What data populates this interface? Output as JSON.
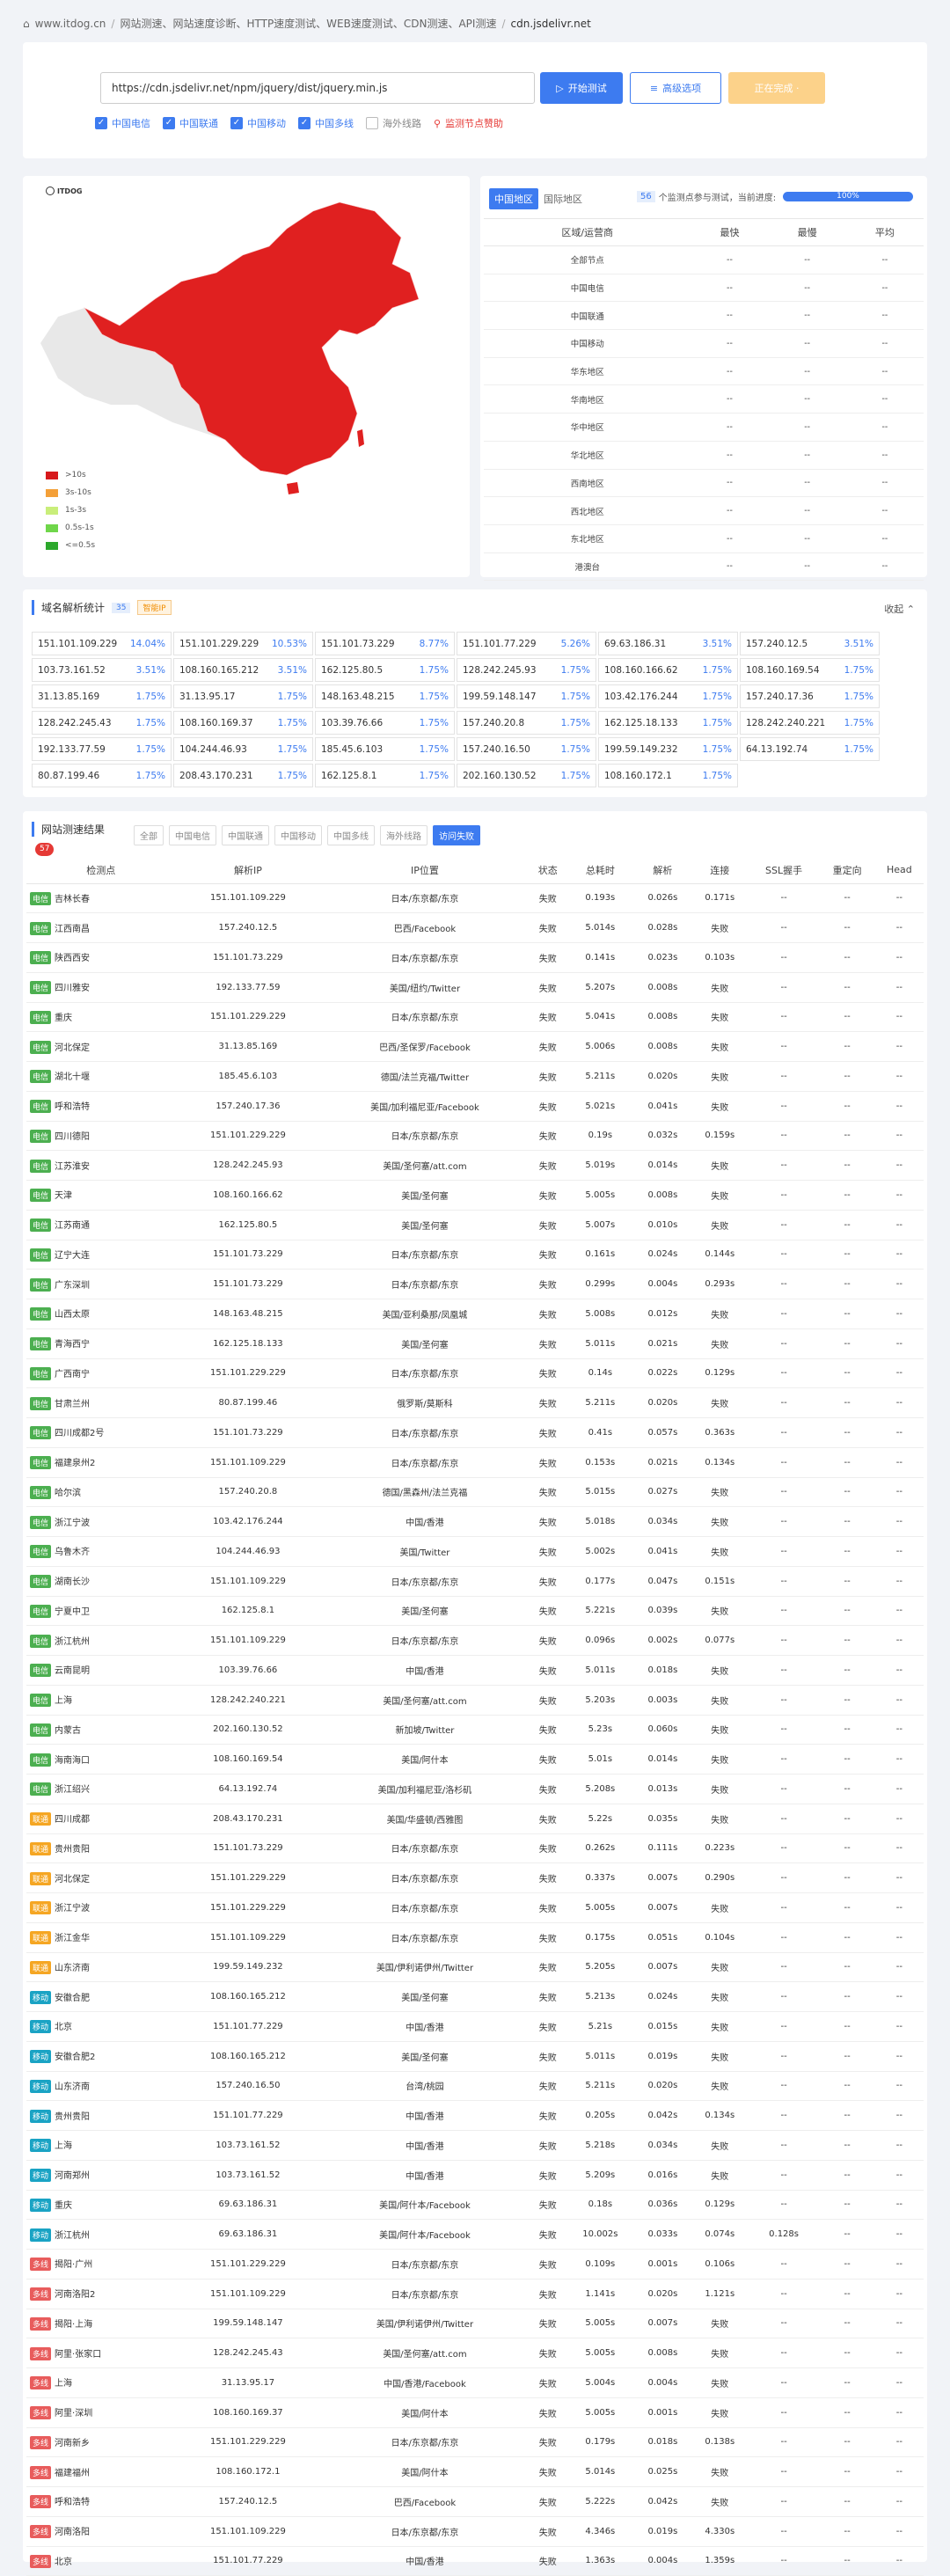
{
  "breadcrumb": [
    "www.itdog.cn",
    "网站测速、网站速度诊断、HTTP速度测试、WEB速度测试、CDN测速、API测速",
    "cdn.jsdelivr.net"
  ],
  "test": {
    "url": "https://cdn.jsdelivr.net/npm/jquery/dist/jquery.min.js",
    "start_label": "开始测试",
    "advanced_label": "高级选项",
    "running_label": "正在完成 ·"
  },
  "lines": [
    {
      "label": "中国电信",
      "checked": true
    },
    {
      "label": "中国联通",
      "checked": true
    },
    {
      "label": "中国移动",
      "checked": true
    },
    {
      "label": "中国多线",
      "checked": true
    },
    {
      "label": "海外线路",
      "checked": false
    }
  ],
  "monitor_label": "监测节点赞助",
  "map": {
    "logo": "ITDOG",
    "legend": [
      {
        "label": ">10s",
        "color": "#d7191c"
      },
      {
        "label": "3s-10s",
        "color": "#f4a038"
      },
      {
        "label": "1s-3s",
        "color": "#c9ee7a"
      },
      {
        "label": "0.5s-1s",
        "color": "#6fd64a"
      },
      {
        "label": "<=0.5s",
        "color": "#2ca82c"
      }
    ]
  },
  "region": {
    "tabs": [
      "中国地区",
      "国际地区"
    ],
    "count": "56",
    "count_text": "个监测点参与测试，当前进度:",
    "progress": "100%",
    "headers": [
      "区域/运营商",
      "最快",
      "最慢",
      "平均"
    ],
    "rows": [
      "全部节点",
      "中国电信",
      "中国联通",
      "中国移动",
      "华东地区",
      "华南地区",
      "华中地区",
      "华北地区",
      "西南地区",
      "西北地区",
      "东北地区",
      "港澳台"
    ],
    "empty": "--"
  },
  "dns": {
    "title": "域名解析统计",
    "count": "35",
    "tag": "智能IP",
    "collapse": "收起",
    "cells": [
      [
        "151.101.109.229",
        "14.04%"
      ],
      [
        "151.101.229.229",
        "10.53%"
      ],
      [
        "151.101.73.229",
        "8.77%"
      ],
      [
        "151.101.77.229",
        "5.26%"
      ],
      [
        "69.63.186.31",
        "3.51%"
      ],
      [
        "157.240.12.5",
        "3.51%"
      ],
      [
        "103.73.161.52",
        "3.51%"
      ],
      [
        "108.160.165.212",
        "3.51%"
      ],
      [
        "162.125.80.5",
        "1.75%"
      ],
      [
        "128.242.245.93",
        "1.75%"
      ],
      [
        "108.160.166.62",
        "1.75%"
      ],
      [
        "108.160.169.54",
        "1.75%"
      ],
      [
        "31.13.85.169",
        "1.75%"
      ],
      [
        "31.13.95.17",
        "1.75%"
      ],
      [
        "148.163.48.215",
        "1.75%"
      ],
      [
        "199.59.148.147",
        "1.75%"
      ],
      [
        "103.42.176.244",
        "1.75%"
      ],
      [
        "157.240.17.36",
        "1.75%"
      ],
      [
        "128.242.245.43",
        "1.75%"
      ],
      [
        "108.160.169.37",
        "1.75%"
      ],
      [
        "103.39.76.66",
        "1.75%"
      ],
      [
        "157.240.20.8",
        "1.75%"
      ],
      [
        "162.125.18.133",
        "1.75%"
      ],
      [
        "128.242.240.221",
        "1.75%"
      ],
      [
        "192.133.77.59",
        "1.75%"
      ],
      [
        "104.244.46.93",
        "1.75%"
      ],
      [
        "185.45.6.103",
        "1.75%"
      ],
      [
        "157.240.16.50",
        "1.75%"
      ],
      [
        "199.59.149.232",
        "1.75%"
      ],
      [
        "64.13.192.74",
        "1.75%"
      ],
      [
        "80.87.199.46",
        "1.75%"
      ],
      [
        "208.43.170.231",
        "1.75%"
      ],
      [
        "162.125.8.1",
        "1.75%"
      ],
      [
        "202.160.130.52",
        "1.75%"
      ],
      [
        "108.160.172.1",
        "1.75%"
      ]
    ]
  },
  "results": {
    "title": "网站测速结果",
    "filters": [
      "全部",
      "中国电信",
      "中国联通",
      "中国移动",
      "中国多线",
      "海外线路",
      "访问失败"
    ],
    "badge": "57",
    "headers": [
      "检测点",
      "解析IP",
      "IP位置",
      "状态",
      "总耗时",
      "解析",
      "连接",
      "SSL握手",
      "重定向",
      "Head"
    ],
    "isp_colors": {
      "电信": "#4caf50",
      "联通": "#f5a623",
      "移动": "#1aa3c4",
      "多线": "#e85c5c"
    },
    "rows": [
      [
        "电信",
        "吉林长春",
        "151.101.109.229",
        "日本/东京都/东京",
        "失败",
        "0.193s",
        "0.026s",
        "0.171s",
        "--",
        "--",
        "--"
      ],
      [
        "电信",
        "江西南昌",
        "157.240.12.5",
        "巴西/Facebook",
        "失败",
        "5.014s",
        "0.028s",
        "失败",
        "--",
        "--",
        "--"
      ],
      [
        "电信",
        "陕西西安",
        "151.101.73.229",
        "日本/东京都/东京",
        "失败",
        "0.141s",
        "0.023s",
        "0.103s",
        "--",
        "--",
        "--"
      ],
      [
        "电信",
        "四川雅安",
        "192.133.77.59",
        "美国/纽约/Twitter",
        "失败",
        "5.207s",
        "0.008s",
        "失败",
        "--",
        "--",
        "--"
      ],
      [
        "电信",
        "重庆",
        "151.101.229.229",
        "日本/东京都/东京",
        "失败",
        "5.041s",
        "0.008s",
        "失败",
        "--",
        "--",
        "--"
      ],
      [
        "电信",
        "河北保定",
        "31.13.85.169",
        "巴西/圣保罗/Facebook",
        "失败",
        "5.006s",
        "0.008s",
        "失败",
        "--",
        "--",
        "--"
      ],
      [
        "电信",
        "湖北十堰",
        "185.45.6.103",
        "德国/法兰克福/Twitter",
        "失败",
        "5.211s",
        "0.020s",
        "失败",
        "--",
        "--",
        "--"
      ],
      [
        "电信",
        "呼和浩特",
        "157.240.17.36",
        "美国/加利福尼亚/Facebook",
        "失败",
        "5.021s",
        "0.041s",
        "失败",
        "--",
        "--",
        "--"
      ],
      [
        "电信",
        "四川德阳",
        "151.101.229.229",
        "日本/东京都/东京",
        "失败",
        "0.19s",
        "0.032s",
        "0.159s",
        "--",
        "--",
        "--"
      ],
      [
        "电信",
        "江苏淮安",
        "128.242.245.93",
        "美国/圣何塞/att.com",
        "失败",
        "5.019s",
        "0.014s",
        "失败",
        "--",
        "--",
        "--"
      ],
      [
        "电信",
        "天津",
        "108.160.166.62",
        "美国/圣何塞",
        "失败",
        "5.005s",
        "0.008s",
        "失败",
        "--",
        "--",
        "--"
      ],
      [
        "电信",
        "江苏南通",
        "162.125.80.5",
        "美国/圣何塞",
        "失败",
        "5.007s",
        "0.010s",
        "失败",
        "--",
        "--",
        "--"
      ],
      [
        "电信",
        "辽宁大连",
        "151.101.73.229",
        "日本/东京都/东京",
        "失败",
        "0.161s",
        "0.024s",
        "0.144s",
        "--",
        "--",
        "--"
      ],
      [
        "电信",
        "广东深圳",
        "151.101.73.229",
        "日本/东京都/东京",
        "失败",
        "0.299s",
        "0.004s",
        "0.293s",
        "--",
        "--",
        "--"
      ],
      [
        "电信",
        "山西太原",
        "148.163.48.215",
        "美国/亚利桑那/凤凰城",
        "失败",
        "5.008s",
        "0.012s",
        "失败",
        "--",
        "--",
        "--"
      ],
      [
        "电信",
        "青海西宁",
        "162.125.18.133",
        "美国/圣何塞",
        "失败",
        "5.011s",
        "0.021s",
        "失败",
        "--",
        "--",
        "--"
      ],
      [
        "电信",
        "广西南宁",
        "151.101.229.229",
        "日本/东京都/东京",
        "失败",
        "0.14s",
        "0.022s",
        "0.129s",
        "--",
        "--",
        "--"
      ],
      [
        "电信",
        "甘肃兰州",
        "80.87.199.46",
        "俄罗斯/莫斯科",
        "失败",
        "5.211s",
        "0.020s",
        "失败",
        "--",
        "--",
        "--"
      ],
      [
        "电信",
        "四川成都2号",
        "151.101.73.229",
        "日本/东京都/东京",
        "失败",
        "0.41s",
        "0.057s",
        "0.363s",
        "--",
        "--",
        "--"
      ],
      [
        "电信",
        "福建泉州2",
        "151.101.109.229",
        "日本/东京都/东京",
        "失败",
        "0.153s",
        "0.021s",
        "0.134s",
        "--",
        "--",
        "--"
      ],
      [
        "电信",
        "哈尔滨",
        "157.240.20.8",
        "德国/黑森州/法兰克福",
        "失败",
        "5.015s",
        "0.027s",
        "失败",
        "--",
        "--",
        "--"
      ],
      [
        "电信",
        "浙江宁波",
        "103.42.176.244",
        "中国/香港",
        "失败",
        "5.018s",
        "0.034s",
        "失败",
        "--",
        "--",
        "--"
      ],
      [
        "电信",
        "乌鲁木齐",
        "104.244.46.93",
        "美国/Twitter",
        "失败",
        "5.002s",
        "0.041s",
        "失败",
        "--",
        "--",
        "--"
      ],
      [
        "电信",
        "湖南长沙",
        "151.101.109.229",
        "日本/东京都/东京",
        "失败",
        "0.177s",
        "0.047s",
        "0.151s",
        "--",
        "--",
        "--"
      ],
      [
        "电信",
        "宁夏中卫",
        "162.125.8.1",
        "美国/圣何塞",
        "失败",
        "5.221s",
        "0.039s",
        "失败",
        "--",
        "--",
        "--"
      ],
      [
        "电信",
        "浙江杭州",
        "151.101.109.229",
        "日本/东京都/东京",
        "失败",
        "0.096s",
        "0.002s",
        "0.077s",
        "--",
        "--",
        "--"
      ],
      [
        "电信",
        "云南昆明",
        "103.39.76.66",
        "中国/香港",
        "失败",
        "5.011s",
        "0.018s",
        "失败",
        "--",
        "--",
        "--"
      ],
      [
        "电信",
        "上海",
        "128.242.240.221",
        "美国/圣何塞/att.com",
        "失败",
        "5.203s",
        "0.003s",
        "失败",
        "--",
        "--",
        "--"
      ],
      [
        "电信",
        "内蒙古",
        "202.160.130.52",
        "新加坡/Twitter",
        "失败",
        "5.23s",
        "0.060s",
        "失败",
        "--",
        "--",
        "--"
      ],
      [
        "电信",
        "海南海口",
        "108.160.169.54",
        "美国/阿什本",
        "失败",
        "5.01s",
        "0.014s",
        "失败",
        "--",
        "--",
        "--"
      ],
      [
        "电信",
        "浙江绍兴",
        "64.13.192.74",
        "美国/加利福尼亚/洛杉矶",
        "失败",
        "5.208s",
        "0.013s",
        "失败",
        "--",
        "--",
        "--"
      ],
      [
        "联通",
        "四川成都",
        "208.43.170.231",
        "美国/华盛顿/西雅图",
        "失败",
        "5.22s",
        "0.035s",
        "失败",
        "--",
        "--",
        "--"
      ],
      [
        "联通",
        "贵州贵阳",
        "151.101.73.229",
        "日本/东京都/东京",
        "失败",
        "0.262s",
        "0.111s",
        "0.223s",
        "--",
        "--",
        "--"
      ],
      [
        "联通",
        "河北保定",
        "151.101.229.229",
        "日本/东京都/东京",
        "失败",
        "0.337s",
        "0.007s",
        "0.290s",
        "--",
        "--",
        "--"
      ],
      [
        "联通",
        "浙江宁波",
        "151.101.229.229",
        "日本/东京都/东京",
        "失败",
        "5.005s",
        "0.007s",
        "失败",
        "--",
        "--",
        "--"
      ],
      [
        "联通",
        "浙江金华",
        "151.101.109.229",
        "日本/东京都/东京",
        "失败",
        "0.175s",
        "0.051s",
        "0.104s",
        "--",
        "--",
        "--"
      ],
      [
        "联通",
        "山东济南",
        "199.59.149.232",
        "美国/伊利诺伊州/Twitter",
        "失败",
        "5.205s",
        "0.007s",
        "失败",
        "--",
        "--",
        "--"
      ],
      [
        "移动",
        "安徽合肥",
        "108.160.165.212",
        "美国/圣何塞",
        "失败",
        "5.213s",
        "0.024s",
        "失败",
        "--",
        "--",
        "--"
      ],
      [
        "移动",
        "北京",
        "151.101.77.229",
        "中国/香港",
        "失败",
        "5.21s",
        "0.015s",
        "失败",
        "--",
        "--",
        "--"
      ],
      [
        "移动",
        "安徽合肥2",
        "108.160.165.212",
        "美国/圣何塞",
        "失败",
        "5.011s",
        "0.019s",
        "失败",
        "--",
        "--",
        "--"
      ],
      [
        "移动",
        "山东济南",
        "157.240.16.50",
        "台湾/桃园",
        "失败",
        "5.211s",
        "0.020s",
        "失败",
        "--",
        "--",
        "--"
      ],
      [
        "移动",
        "贵州贵阳",
        "151.101.77.229",
        "中国/香港",
        "失败",
        "0.205s",
        "0.042s",
        "0.134s",
        "--",
        "--",
        "--"
      ],
      [
        "移动",
        "上海",
        "103.73.161.52",
        "中国/香港",
        "失败",
        "5.218s",
        "0.034s",
        "失败",
        "--",
        "--",
        "--"
      ],
      [
        "移动",
        "河南郑州",
        "103.73.161.52",
        "中国/香港",
        "失败",
        "5.209s",
        "0.016s",
        "失败",
        "--",
        "--",
        "--"
      ],
      [
        "移动",
        "重庆",
        "69.63.186.31",
        "美国/阿什本/Facebook",
        "失败",
        "0.18s",
        "0.036s",
        "0.129s",
        "--",
        "--",
        "--"
      ],
      [
        "移动",
        "浙江杭州",
        "69.63.186.31",
        "美国/阿什本/Facebook",
        "失败",
        "10.002s",
        "0.033s",
        "0.074s",
        "0.128s",
        "--",
        "--"
      ],
      [
        "多线",
        "揭阳·广州",
        "151.101.229.229",
        "日本/东京都/东京",
        "失败",
        "0.109s",
        "0.001s",
        "0.106s",
        "--",
        "--",
        "--"
      ],
      [
        "多线",
        "河南洛阳2",
        "151.101.109.229",
        "日本/东京都/东京",
        "失败",
        "1.141s",
        "0.020s",
        "1.121s",
        "--",
        "--",
        "--"
      ],
      [
        "多线",
        "揭阳·上海",
        "199.59.148.147",
        "美国/伊利诺伊州/Twitter",
        "失败",
        "5.005s",
        "0.007s",
        "失败",
        "--",
        "--",
        "--"
      ],
      [
        "多线",
        "阿里·张家口",
        "128.242.245.43",
        "美国/圣何塞/att.com",
        "失败",
        "5.005s",
        "0.008s",
        "失败",
        "--",
        "--",
        "--"
      ],
      [
        "多线",
        "上海",
        "31.13.95.17",
        "中国/香港/Facebook",
        "失败",
        "5.004s",
        "0.004s",
        "失败",
        "--",
        "--",
        "--"
      ],
      [
        "多线",
        "阿里·深圳",
        "108.160.169.37",
        "美国/阿什本",
        "失败",
        "5.005s",
        "0.001s",
        "失败",
        "--",
        "--",
        "--"
      ],
      [
        "多线",
        "河南新乡",
        "151.101.229.229",
        "日本/东京都/东京",
        "失败",
        "0.179s",
        "0.018s",
        "0.138s",
        "--",
        "--",
        "--"
      ],
      [
        "多线",
        "福建福州",
        "108.160.172.1",
        "美国/阿什本",
        "失败",
        "5.014s",
        "0.025s",
        "失败",
        "--",
        "--",
        "--"
      ],
      [
        "多线",
        "呼和浩特",
        "157.240.12.5",
        "巴西/Facebook",
        "失败",
        "5.222s",
        "0.042s",
        "失败",
        "--",
        "--",
        "--"
      ],
      [
        "多线",
        "河南洛阳",
        "151.101.109.229",
        "日本/东京都/东京",
        "失败",
        "4.346s",
        "0.019s",
        "4.330s",
        "--",
        "--",
        "--"
      ],
      [
        "多线",
        "北京",
        "151.101.77.229",
        "中国/香港",
        "失败",
        "1.363s",
        "0.004s",
        "1.359s",
        "--",
        "--",
        "--"
      ]
    ]
  }
}
